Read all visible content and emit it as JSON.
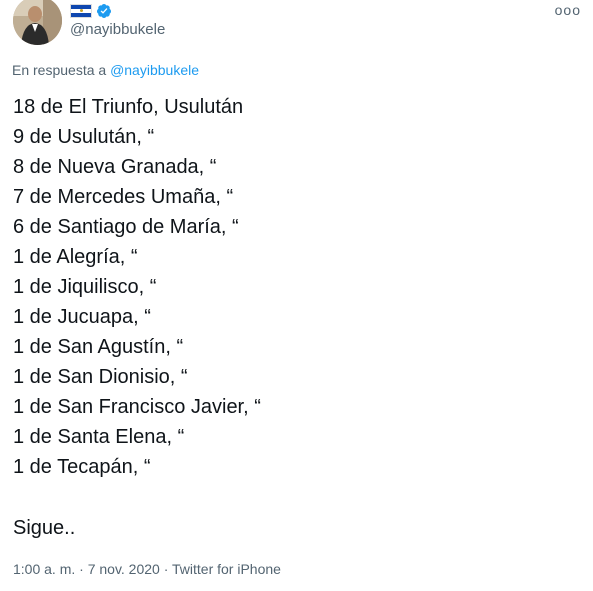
{
  "tweet": {
    "handle": "@nayibbukele",
    "more_label": "ooo",
    "reply_prefix": "En respuesta a",
    "reply_to": "@nayibbukele",
    "lines": [
      "18 de El Triunfo, Usulután",
      "9 de Usulután, “",
      "8 de Nueva Granada, “",
      "7 de Mercedes Umaña, “",
      "6 de Santiago de María, “",
      "1 de Alegría, “",
      "1 de Jiquilisco, “",
      "1 de Jucuapa, “",
      "1 de San Agustín, “",
      "1 de San Dionisio, “",
      "1 de San Francisco Javier, “",
      "1 de Santa Elena, “",
      "1 de Tecapán, “"
    ],
    "closing": "Sigue..",
    "meta": "1:00 a. m. · 7 nov. 2020 · Twitter for iPhone"
  },
  "icons": {
    "flag": "el-salvador-flag-emoji",
    "verified": "verified-badge-icon",
    "more": "more-options-icon"
  },
  "colors": {
    "link": "#1d9bf0",
    "secondary_text": "#536471",
    "primary_text": "#0f1419"
  }
}
